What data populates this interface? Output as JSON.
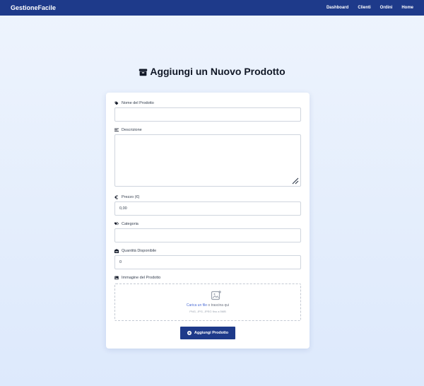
{
  "nav": {
    "brand": "GestioneFacile",
    "links": [
      "Dashboard",
      "Clienti",
      "Ordini",
      "Home"
    ]
  },
  "page_title": "Aggiungi un Nuovo Prodotto",
  "form": {
    "name_label": "Nome del Prodotto",
    "name_value": "",
    "description_label": "Descrizione",
    "description_value": "",
    "price_label": "Prezzo (€)",
    "price_value": "0,00",
    "category_label": "Categoria",
    "category_value": "",
    "quantity_label": "Quantità Disponibile",
    "quantity_value": "0",
    "image_label": "Immagine del Prodotto",
    "upload_link": "Carica un file",
    "upload_rest": " o trascina qui",
    "upload_hint": "PNG, JPG, JPEG fino a 5MB",
    "submit_label": "Aggiungi Prodotto"
  },
  "colors": {
    "primary": "#1e3a8a",
    "background_top": "#eef4fd",
    "background_bottom": "#dde9fc",
    "link": "#4f6fd6"
  },
  "icons": {
    "title": "box-icon",
    "name": "tag-icon",
    "description": "align-left-icon",
    "price": "euro-icon",
    "category": "tags-icon",
    "quantity": "warehouse-icon",
    "image": "image-icon",
    "upload": "image-upload-icon",
    "submit": "plus-circle-icon"
  }
}
